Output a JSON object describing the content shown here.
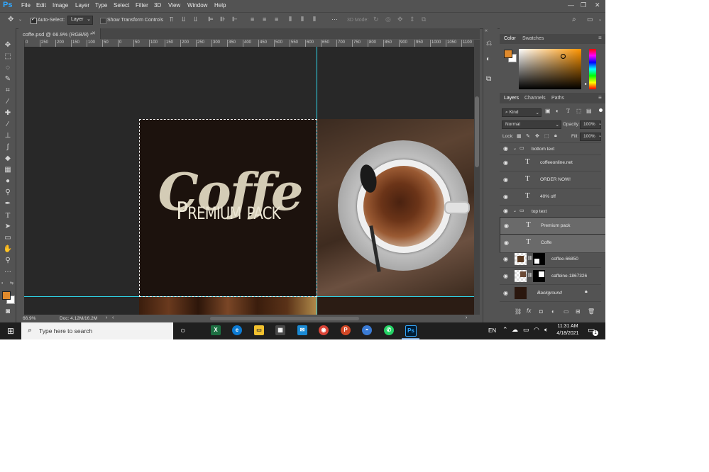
{
  "app": {
    "logo": "Ps",
    "menu": [
      "File",
      "Edit",
      "Image",
      "Layer",
      "Type",
      "Select",
      "Filter",
      "3D",
      "View",
      "Window",
      "Help"
    ]
  },
  "options": {
    "auto_select_label": "Auto-Select:",
    "auto_select_value": "Layer",
    "transform_label": "Show Transform Controls",
    "mode_3d_label": "3D Mode:"
  },
  "document": {
    "tab_title": "coffe.psd @ 66.9% (RGB/8) *",
    "zoom": "66.9%",
    "doc_size": "Doc: 4.12M/16.2M",
    "ruler_ticks": [
      "0",
      "250",
      "200",
      "150",
      "100",
      "50",
      "0",
      "50",
      "100",
      "150",
      "200",
      "250",
      "300",
      "350",
      "400",
      "450",
      "500",
      "550",
      "600",
      "650",
      "700",
      "750",
      "800",
      "850",
      "900",
      "950",
      "1000",
      "1050",
      "1100"
    ],
    "art_title": "Coffe",
    "art_subtitle": "Premium pack"
  },
  "colors": {
    "foreground": "#e08a2c",
    "background": "#ffffff",
    "accent": "#31a8ff",
    "guide": "#2fd3e6"
  },
  "color_panel": {
    "tabs": [
      "Color",
      "Swatches"
    ]
  },
  "layers_panel": {
    "tabs": [
      "Layers",
      "Channels",
      "Paths"
    ],
    "kind_label": "Kind",
    "blend_mode": "Normal",
    "opacity_label": "Opacity:",
    "opacity_value": "100%",
    "lock_label": "Lock:",
    "fill_label": "Fill:",
    "fill_value": "100%",
    "layers": [
      {
        "name": "bottom text",
        "kind": "group"
      },
      {
        "name": "coffeeonline.net",
        "kind": "text"
      },
      {
        "name": "ORDER NOW!",
        "kind": "text"
      },
      {
        "name": "40% off",
        "kind": "text"
      },
      {
        "name": "top text",
        "kind": "group"
      },
      {
        "name": "Premium pack",
        "kind": "text",
        "selected": true
      },
      {
        "name": "Coffe",
        "kind": "text",
        "selected": true
      },
      {
        "name": "coffee-66850",
        "kind": "image"
      },
      {
        "name": "caffeine-1867326",
        "kind": "image"
      },
      {
        "name": "Background",
        "kind": "background"
      }
    ]
  },
  "taskbar": {
    "search_placeholder": "Type here to search",
    "language": "EN",
    "time": "11:31 AM",
    "date": "4/18/2021",
    "notification_count": "1"
  }
}
